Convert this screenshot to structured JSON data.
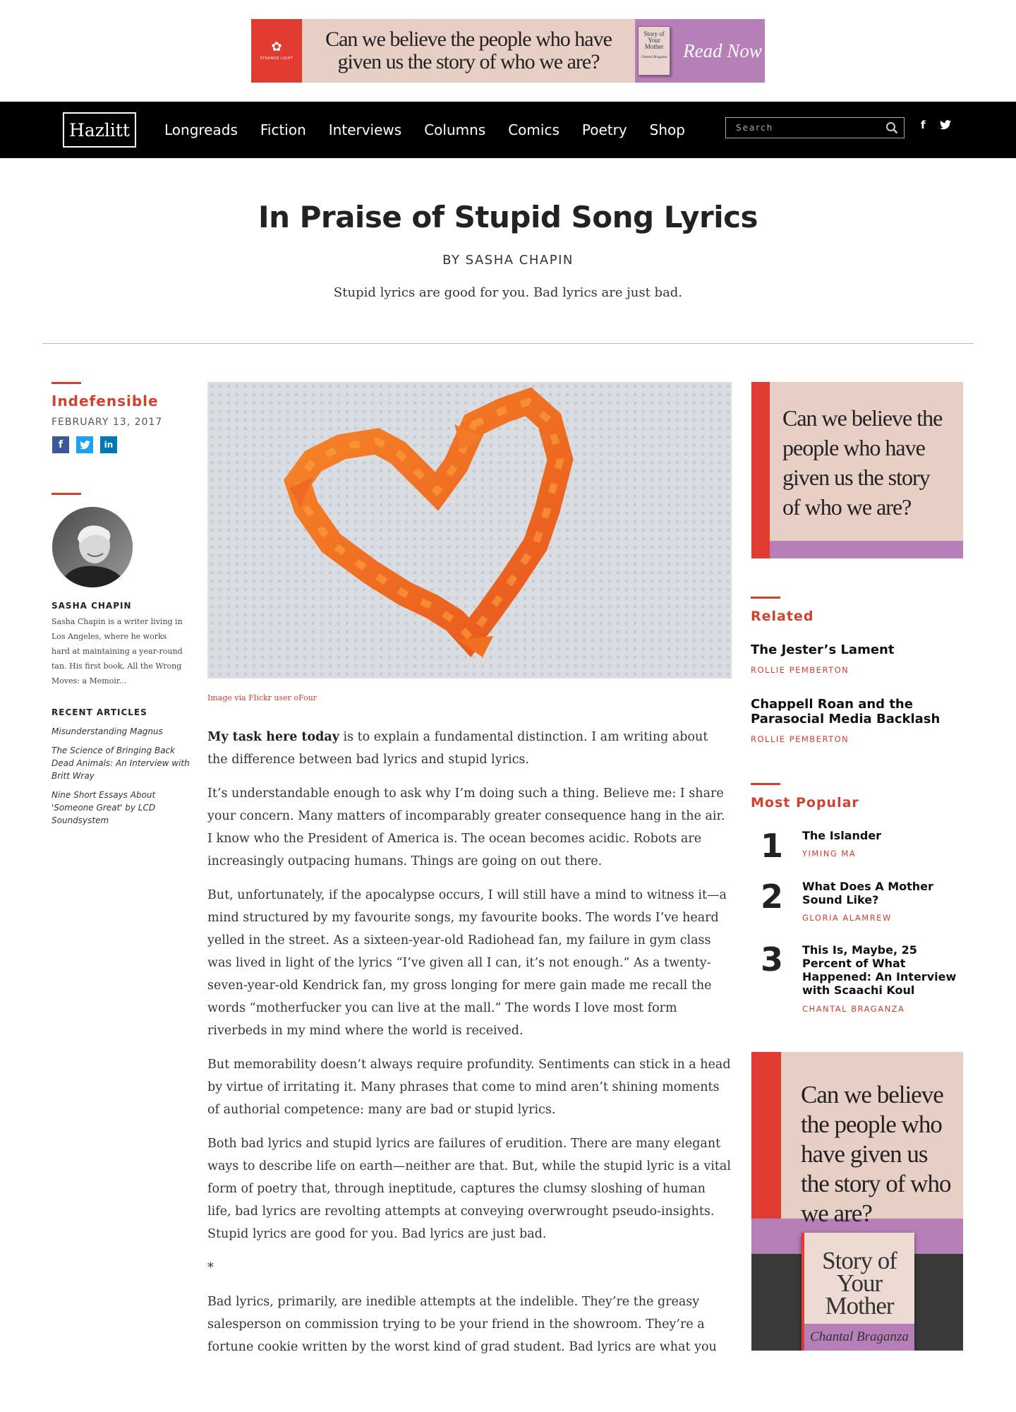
{
  "top_ad": {
    "brand": "STRANGE LIGHT",
    "headline": "Can we believe the people who have given us the story of who we are?",
    "book_title": "Story of Your Mother",
    "book_author": "Chantal Braganza",
    "cta": "Read Now",
    "colors": {
      "red": "#e23c32",
      "pink": "#e8cfc6",
      "purple": "#b77fb7"
    }
  },
  "nav": {
    "logo": "Hazlitt",
    "links": [
      "Longreads",
      "Fiction",
      "Interviews",
      "Columns",
      "Comics",
      "Poetry",
      "Shop"
    ],
    "search_placeholder": "Search",
    "facebook": "f",
    "twitter": "t"
  },
  "article": {
    "title": "In Praise of Stupid Song Lyrics",
    "byline": "BY SASHA CHAPIN",
    "dek": "Stupid lyrics are good for you. Bad lyrics are just bad.",
    "image_caption": "Image via Flickr user oFour",
    "lead_bold": "My task here today",
    "lead_rest": " is to explain a fundamental distinction. I am writing about the difference between bad lyrics and stupid lyrics.",
    "paragraphs": [
      "It’s understandable enough to ask why I’m doing such a thing. Believe me: I share your concern. Many matters of incomparably greater consequence hang in the air. I know who the President of America is. The ocean becomes acidic. Robots are increasingly outpacing humans. Things are going on out there.",
      "But, unfortunately, if the apocalypse occurs, I will still have a mind to witness it—a mind structured by my favourite songs, my favourite books. The words I’ve heard yelled in the street. As a sixteen-year-old Radiohead fan, my failure in gym class was lived in light of the lyrics “I’ve given all I can, it’s not enough.” As a twenty-seven-year-old Kendrick fan, my gross longing for mere gain made me recall the words “motherfucker you can live at the mall.” The words I love most form riverbeds in my mind where the world is received.",
      "But memorability doesn’t always require profundity. Sentiments can stick in a head by virtue of irritating it. Many phrases that come to mind aren’t shining moments of authorial competence: many are bad or stupid lyrics.",
      "Both bad lyrics and stupid lyrics are failures of erudition. There are many elegant ways to describe life on earth—neither are that. But, while the stupid lyric is a vital form of poetry that, through ineptitude, captures the clumsy sloshing of human life, bad lyrics are revolting attempts at conveying overwrought pseudo-insights. Stupid lyrics are good for you. Bad lyrics are just bad.",
      "*",
      "Bad lyrics, primarily, are inedible attempts at the indelible. They’re the greasy salesperson on commission trying to be your friend in the showroom. They’re a fortune cookie written by the worst kind of grad student. Bad lyrics are what you write when you think you’re Leonard Cohen, but you’re actually a Dorito."
    ]
  },
  "left": {
    "column_name": "Indefensible",
    "date": "FEBRUARY 13, 2017",
    "share": {
      "facebook": "f",
      "twitter": "t",
      "linkedin": "in"
    },
    "author_name": "SASHA CHAPIN",
    "author_bio": "Sasha Chapin is a writer living in Los Angeles, where he works hard at maintaining a year-round tan. His first book, All the Wrong Moves: a Memoir...",
    "recent_heading": "RECENT ARTICLES",
    "recent": [
      "Misunderstanding Magnus",
      "The Science of Bringing Back Dead Animals: An Interview with Britt Wray",
      "Nine Short Essays About 'Someone Great' by LCD Soundsystem"
    ]
  },
  "right": {
    "ad_text": "Can we believe the people who have given us the story of who we are?",
    "related_heading": "Related",
    "related": [
      {
        "title": "The Jester’s Lament",
        "author": "ROLLIE PEMBERTON"
      },
      {
        "title": "Chappell Roan and the Parasocial Media Backlash",
        "author": "ROLLIE PEMBERTON"
      }
    ],
    "popular_heading": "Most Popular",
    "popular": [
      {
        "rank": "1",
        "title": "The Islander",
        "author": "YIMING MA"
      },
      {
        "rank": "2",
        "title": "What Does A Mother Sound Like?",
        "author": "GLORIA ALAMREW"
      },
      {
        "rank": "3",
        "title": "This Is, Maybe, 25 Percent of What Happened: An Interview with Scaachi Koul",
        "author": "CHANTAL BRAGANZA"
      }
    ],
    "tall_ad_text": "Can we believe the people who have given us the story of who we are?",
    "tall_ad_book_title": "Story of Your Mother",
    "tall_ad_book_author": "Chantal Braganza"
  },
  "accent_color": "#d4402e"
}
